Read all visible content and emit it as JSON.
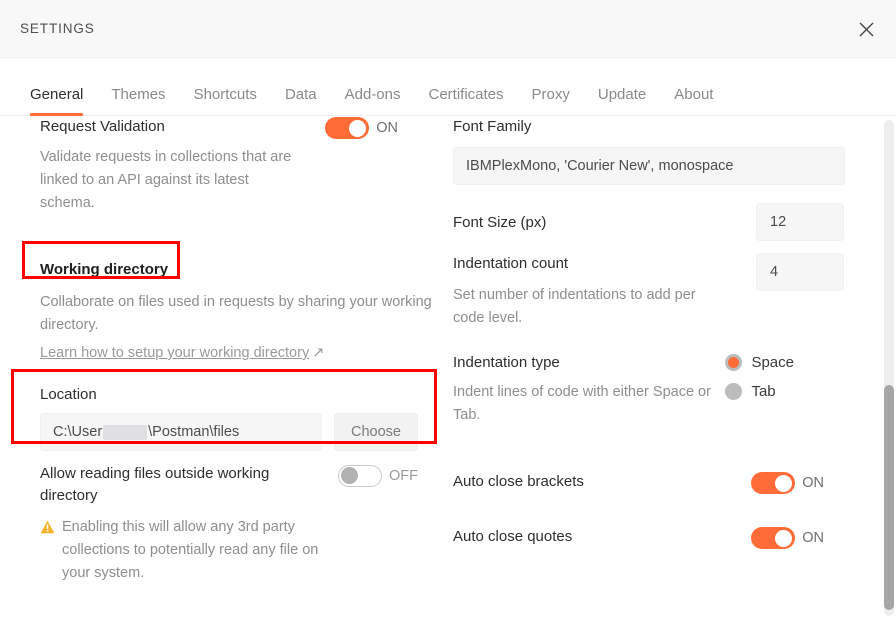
{
  "window": {
    "title": "SETTINGS",
    "close_icon": "close-icon"
  },
  "tabs": [
    {
      "label": "General",
      "active": true
    },
    {
      "label": "Themes",
      "active": false
    },
    {
      "label": "Shortcuts",
      "active": false
    },
    {
      "label": "Data",
      "active": false
    },
    {
      "label": "Add-ons",
      "active": false
    },
    {
      "label": "Certificates",
      "active": false
    },
    {
      "label": "Proxy",
      "active": false
    },
    {
      "label": "Update",
      "active": false
    },
    {
      "label": "About",
      "active": false
    }
  ],
  "left_column": {
    "request_validation": {
      "label": "Request Validation",
      "toggle_state": "ON",
      "helper": "Validate requests in collections that are linked to an API against its latest schema."
    },
    "working_directory": {
      "heading": "Working directory",
      "helper": "Collaborate on files used in requests by sharing your working directory.",
      "link_text": "Learn how to setup your working directory",
      "link_arrow": "↗"
    },
    "location": {
      "label": "Location",
      "value_prefix": "C:\\User",
      "value_suffix": "\\Postman\\files",
      "redacted": true,
      "choose_label": "Choose"
    },
    "allow_reading": {
      "label": "Allow reading files outside working directory",
      "toggle_state": "OFF",
      "warning_icon": "warning-triangle-icon",
      "warning_text": "Enabling this will allow any 3rd party collections to potentially read any file on your system."
    }
  },
  "right_column": {
    "font_family": {
      "label": "Font Family",
      "value": "IBMPlexMono, 'Courier New', monospace"
    },
    "font_size": {
      "label": "Font Size (px)",
      "value": "12"
    },
    "indentation_count": {
      "label": "Indentation count",
      "value": "4",
      "helper": "Set number of indentations to add per code level."
    },
    "indentation_type": {
      "label": "Indentation type",
      "helper": "Indent lines of code with either Space or Tab.",
      "options": [
        {
          "label": "Space",
          "selected": true
        },
        {
          "label": "Tab",
          "selected": false
        }
      ]
    },
    "auto_close_brackets": {
      "label": "Auto close brackets",
      "toggle_state": "ON"
    },
    "auto_close_quotes": {
      "label": "Auto close quotes",
      "toggle_state": "ON"
    }
  },
  "colors": {
    "accent": "#ff6c37",
    "annotation": "#ff0000",
    "warning": "#f5b32a",
    "header_bg": "#f8f8f8",
    "input_bg": "#f6f6f6"
  }
}
